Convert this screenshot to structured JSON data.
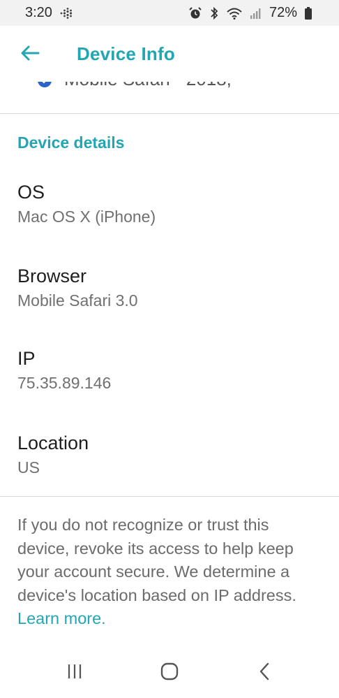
{
  "status_bar": {
    "time": "3:20",
    "battery": "72%",
    "icons": [
      "fitbit-dots-icon",
      "alarm-icon",
      "bluetooth-icon",
      "wifi-icon",
      "signal-icon",
      "battery-icon"
    ]
  },
  "app_bar": {
    "title": "Device Info",
    "back_icon": "arrow-left-icon"
  },
  "previous_item": {
    "text": "Mobile Safari - 2018,"
  },
  "section": {
    "title": "Device details"
  },
  "details": [
    {
      "label": "OS",
      "value": "Mac OS X (iPhone)"
    },
    {
      "label": "Browser",
      "value": "Mobile Safari 3.0"
    },
    {
      "label": "IP",
      "value": "75.35.89.146"
    },
    {
      "label": "Location",
      "value": "US"
    }
  ],
  "info": {
    "text": "If you do not recognize or trust this device, revoke its access to help keep your account secure. We determine a device's location based on IP address. ",
    "link": "Learn more."
  },
  "colors": {
    "accent": "#21a6b3",
    "status_bar_bg": "#f2f2f2",
    "check_blue": "#2b63c9"
  },
  "nav_bar": {
    "icons": [
      "recents-icon",
      "home-icon",
      "back-chevron-icon"
    ]
  }
}
